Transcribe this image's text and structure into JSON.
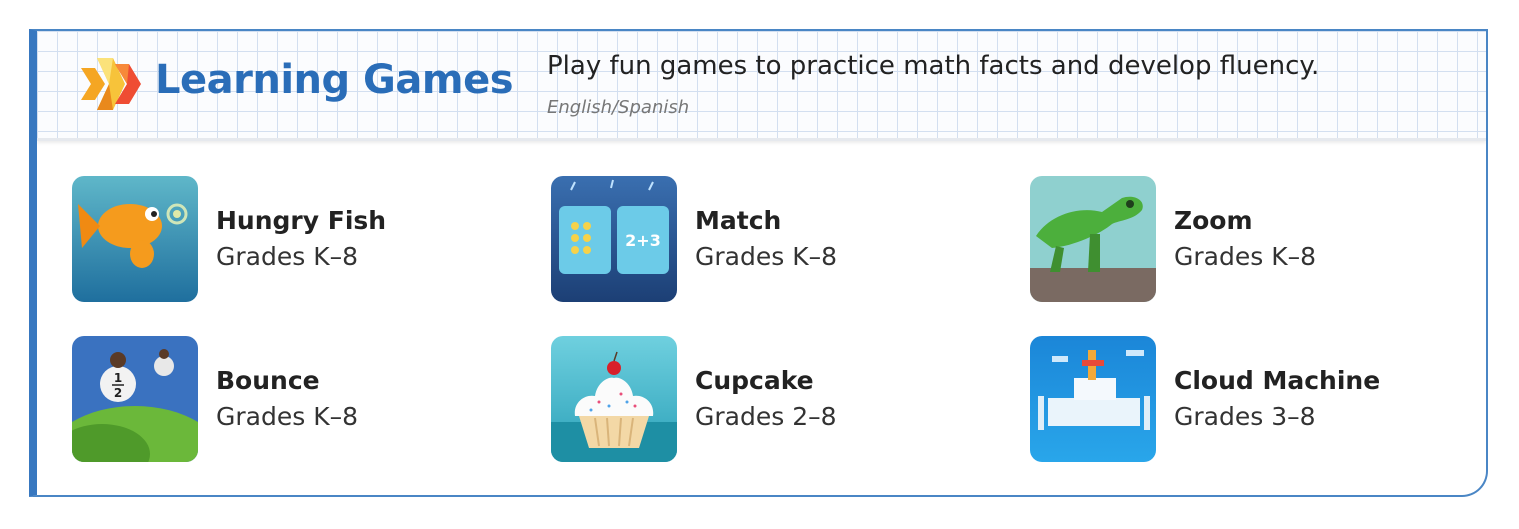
{
  "header": {
    "title": "Learning Games",
    "description": "Play fun games to practice math facts and develop fluency.",
    "languages": "English/Spanish",
    "logo_icon": "learning-games-logo-icon"
  },
  "colors": {
    "brand_blue": "#2a6db8",
    "border_blue": "#3878c0"
  },
  "games": [
    {
      "name": "Hungry Fish",
      "grades": "Grades K–8",
      "icon": "hungry-fish-icon"
    },
    {
      "name": "Match",
      "grades": "Grades K–8",
      "icon": "match-icon",
      "tile_a": "",
      "tile_b": "2+3"
    },
    {
      "name": "Zoom",
      "grades": "Grades K–8",
      "icon": "zoom-icon"
    },
    {
      "name": "Bounce",
      "grades": "Grades K–8",
      "icon": "bounce-icon",
      "fraction_top": "1",
      "fraction_bottom": "2"
    },
    {
      "name": "Cupcake",
      "grades": "Grades 2–8",
      "icon": "cupcake-icon"
    },
    {
      "name": "Cloud Machine",
      "grades": "Grades 3–8",
      "icon": "cloud-machine-icon"
    }
  ]
}
